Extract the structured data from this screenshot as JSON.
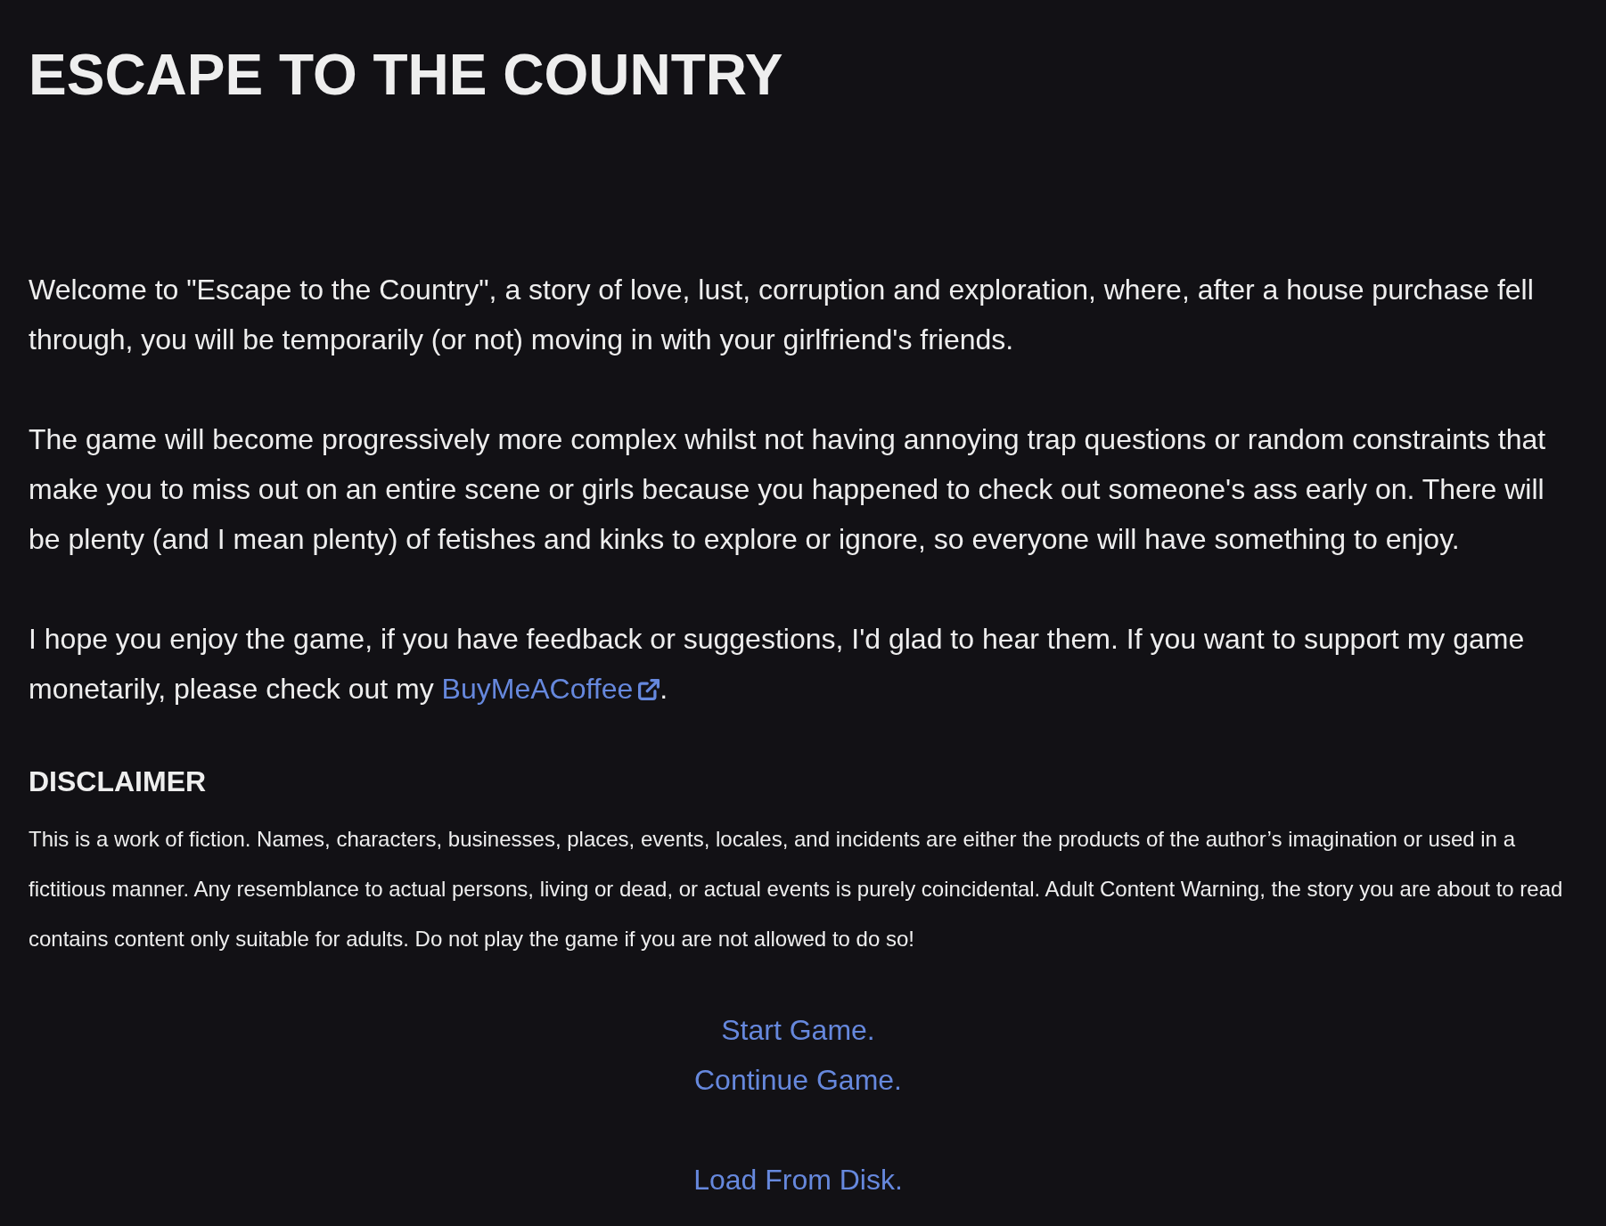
{
  "title": "ESCAPE TO THE COUNTRY",
  "paragraphs": [
    {
      "text": "Welcome to \"Escape to the Country\", a story of love, lust, corruption and exploration, where, after a house purchase fell through, you will be temporarily (or not) moving in with your girlfriend's friends."
    },
    {
      "text": "The game will become progressively more complex whilst not having annoying trap questions or random constraints that make you to miss out on an entire scene or girls because you happened to check out someone's ass early on. There will be plenty (and I mean plenty) of fetishes and kinks to explore or ignore, so everyone will have something to enjoy."
    },
    {
      "text": "I hope you enjoy the game, if you have feedback or suggestions, I'd glad to hear them. If you want to support my game monetarily, please check out my ",
      "link": {
        "label": "BuyMeACoffee",
        "external": true
      },
      "text_after": "."
    }
  ],
  "disclaimer": {
    "heading": "DISCLAIMER",
    "text": "This is a work of fiction. Names, characters, businesses, places, events, locales, and incidents are either the products of the author’s imagination or used in a fictitious manner. Any resemblance to actual persons, living or dead, or actual events is purely coincidental. Adult Content Warning, the story you are about to read contains content only suitable for adults. Do not play the game if you are not allowed to do so!"
  },
  "menu_groups": [
    {
      "links": [
        {
          "label": "Start Game."
        },
        {
          "label": "Continue Game."
        }
      ]
    },
    {
      "links": [
        {
          "label": "Load From Disk."
        }
      ]
    }
  ]
}
